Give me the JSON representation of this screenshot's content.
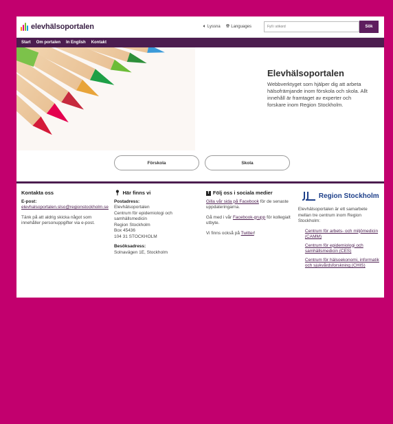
{
  "header": {
    "logo_text": "elevhälsoportalen",
    "listen_label": "Lyssna",
    "language_label": "Languages",
    "search_placeholder": "Fyll i sökord",
    "search_button": "Sök"
  },
  "nav": {
    "items": [
      "Start",
      "Om portalen",
      "In English",
      "Kontakt"
    ]
  },
  "hero": {
    "title": "Elevhälsoportalen",
    "description": "Webbverktyget som hjälper dig att arbeta hälsofrämjande inom förskola och skola. Allt innehåll är framtaget av experter och forskare inom Region Stockholm."
  },
  "choices": {
    "forskola": "Förskola",
    "skola": "Skola"
  },
  "footer": {
    "contact": {
      "title": "Kontakta oss",
      "email_label": "E-post:",
      "email": "elevhalsoportalen.slso@regionstockholm.se",
      "note": "Tänk på att aldrig skicka något som innehåller personuppgifter via e-post."
    },
    "location": {
      "title": "Här finns vi",
      "postal_label": "Postadress:",
      "postal_lines": [
        "Elevhälsoportalen",
        "Centrum för epidemiologi och samhällsmedicin",
        "Region Stockholm",
        "Box 45436",
        "104 31 STOCKHOLM"
      ],
      "visit_label": "Besöksadress:",
      "visit_address": "Solnavägen 1E, Stockholm"
    },
    "social": {
      "title": "Följ oss i sociala medier",
      "p1_link": "Gilla vår sida på Facebook",
      "p1_rest": " för de senaste uppdateringarna.",
      "p2_pre": "Gå med i vår ",
      "p2_link": "Facebook-grupp",
      "p2_rest": " för kollegialt utbyte.",
      "p3_pre": "Vi finns också på ",
      "p3_link": "Twitter",
      "p3_rest": "!"
    },
    "region": {
      "logo_text": "Region Stockholm",
      "intro": "Elevhälsoportalen är ett samarbete mellan tre centrum inom Region Stockholm:",
      "partners": [
        "Centrum för arbets- och miljömedicin (CAMM)",
        "Centrum för epidemiologi och samhällsmedicin (CES)",
        "Centrum för hälsoekonomi, informatik och sjukvårdsforskning (CHIS)"
      ]
    }
  },
  "colors": {
    "background": "#c2006e",
    "brand_purple": "#4c1d4f",
    "region_blue": "#1d3f8a"
  }
}
